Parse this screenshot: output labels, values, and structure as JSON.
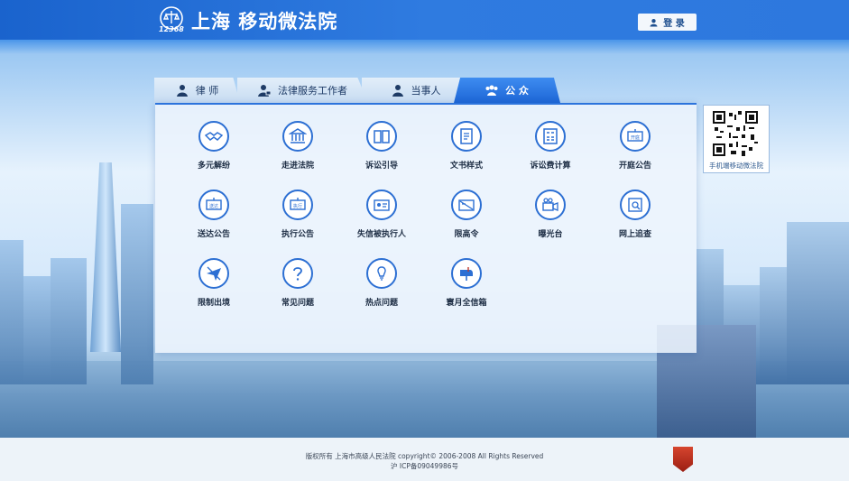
{
  "header": {
    "title": "上海 移动微法院",
    "badge": "12368",
    "login_label": "登 录"
  },
  "tabs": [
    {
      "label": "律  师",
      "icon": "user-icon",
      "active": false
    },
    {
      "label": "法律服务工作者",
      "icon": "user-work-icon",
      "active": false
    },
    {
      "label": "当事人",
      "icon": "user-icon",
      "active": false
    },
    {
      "label": "公  众",
      "icon": "group-icon",
      "active": true
    }
  ],
  "services": [
    {
      "label": "多元解纷",
      "icon": "handshake-icon"
    },
    {
      "label": "走进法院",
      "icon": "court-building-icon"
    },
    {
      "label": "诉讼引导",
      "icon": "book-icon"
    },
    {
      "label": "文书样式",
      "icon": "document-icon"
    },
    {
      "label": "诉讼费计算",
      "icon": "calculator-icon"
    },
    {
      "label": "开庭公告",
      "icon": "notice-board-icon",
      "badge": "开庭"
    },
    {
      "label": "送达公告",
      "icon": "delivery-notice-icon",
      "badge": "送达"
    },
    {
      "label": "执行公告",
      "icon": "execution-notice-icon",
      "badge": "执行"
    },
    {
      "label": "失信被执行人",
      "icon": "id-card-icon"
    },
    {
      "label": "限高令",
      "icon": "restriction-card-icon"
    },
    {
      "label": "曝光台",
      "icon": "camera-icon"
    },
    {
      "label": "网上追查",
      "icon": "search-document-icon"
    },
    {
      "label": "限制出境",
      "icon": "plane-icon"
    },
    {
      "label": "常见问题",
      "icon": "question-icon"
    },
    {
      "label": "热点问题",
      "icon": "lightbulb-icon"
    },
    {
      "label": "寰月全信箱",
      "icon": "mailbox-icon"
    }
  ],
  "qr": {
    "caption": "手机端移动微法院"
  },
  "footer": {
    "copyright": "版权所有 上海市高级人民法院 copyright© 2006-2008 All Rights Reserved",
    "icp": "沪 ICP备09049986号"
  },
  "colors": {
    "header_blue": "#1a63cd",
    "accent_blue": "#2c6fd3",
    "panel_bg": "#eef5fd"
  }
}
